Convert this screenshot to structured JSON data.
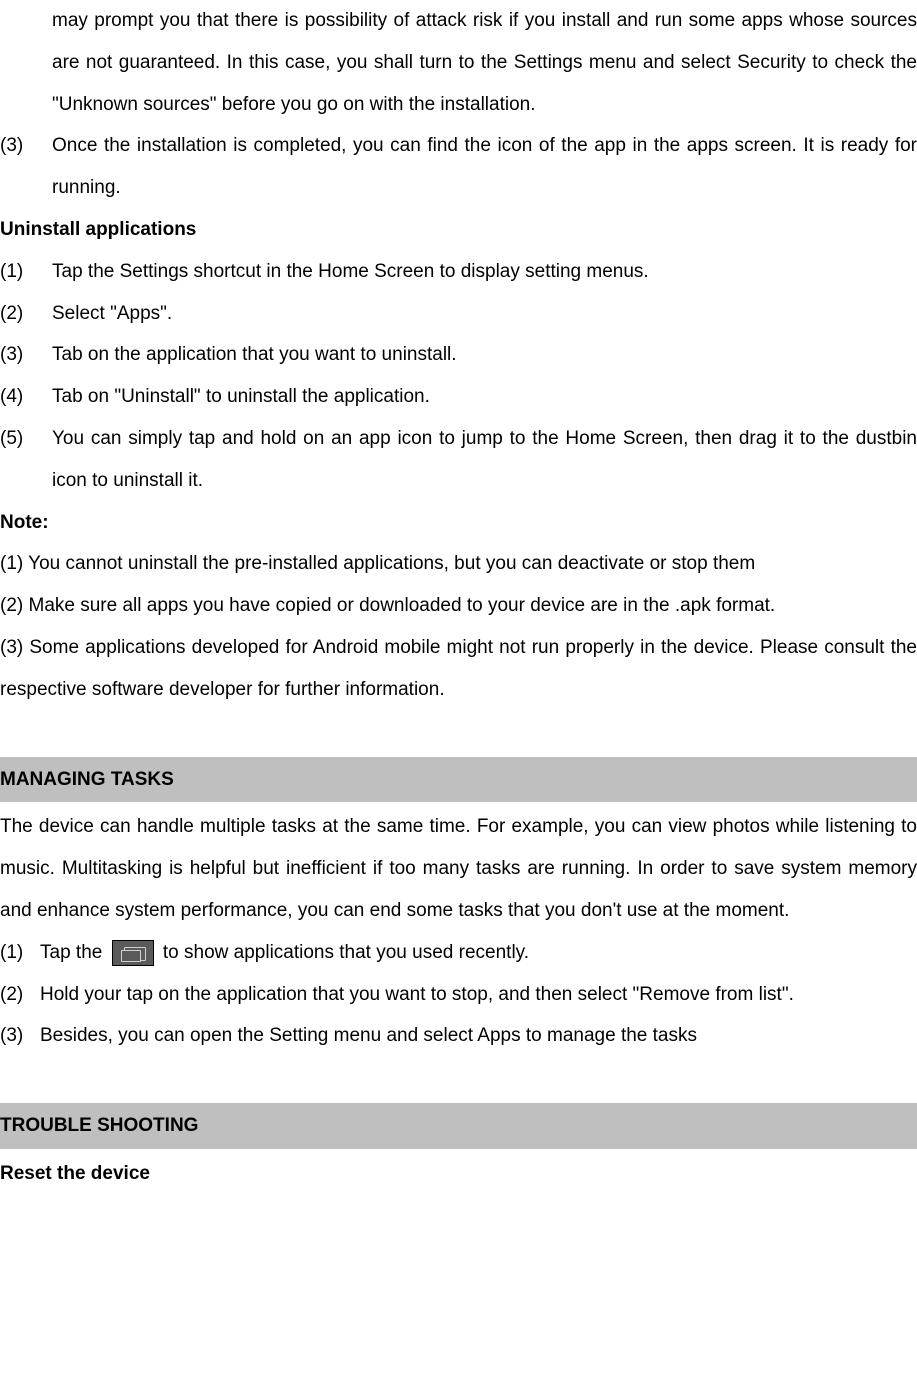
{
  "top": {
    "cont1": "may prompt you that there is possibility of attack risk if you install and run some apps whose sources are not guaranteed. In this case, you shall turn to the Settings menu and select Security to check the \"Unknown sources\" before you go on with the installation.",
    "item3_num": "(3)",
    "item3_text": "Once the installation is completed, you can find the icon of the app in the apps screen. It is ready for running."
  },
  "uninstall": {
    "heading": "Uninstall applications",
    "items": [
      {
        "num": "(1)",
        "text": "Tap the Settings shortcut in the Home Screen to display setting menus."
      },
      {
        "num": "(2)",
        "text": "Select \"Apps\"."
      },
      {
        "num": "(3)",
        "text": "Tab on the application that you want to uninstall."
      },
      {
        "num": "(4)",
        "text": "Tab on \"Uninstall\" to uninstall the application."
      },
      {
        "num": "(5)",
        "text": "You can simply tap and hold on an app icon to jump to the Home Screen, then drag it to the dustbin icon to uninstall it."
      }
    ]
  },
  "note": {
    "heading": "Note:",
    "items": [
      "(1) You cannot uninstall the pre-installed applications, but you can deactivate or stop them",
      "(2) Make sure all apps you have copied or downloaded to your device are in the .apk format.",
      "(3) Some applications developed for Android mobile might not run properly in the device. Please consult the respective software developer for further information."
    ]
  },
  "managing": {
    "heading": "MANAGING TASKS",
    "intro": "The device can handle multiple tasks at the same time. For example, you can view photos while listening to music. Multitasking is helpful but inefficient if too many tasks are running. In order to save system memory and enhance system performance, you can end some tasks that you don't use at the moment.",
    "item1_num": "(1)",
    "item1_before": "Tap the ",
    "item1_after": " to show applications that you used recently.",
    "item2_num": "(2)",
    "item2_text": "Hold your tap on the application that you want to stop, and then select \"Remove from list\".",
    "item3_num": "(3)",
    "item3_text": "Besides, you can open the Setting menu and select Apps to manage the tasks"
  },
  "trouble": {
    "heading": "TROUBLE SHOOTING",
    "sub": "Reset the device"
  }
}
